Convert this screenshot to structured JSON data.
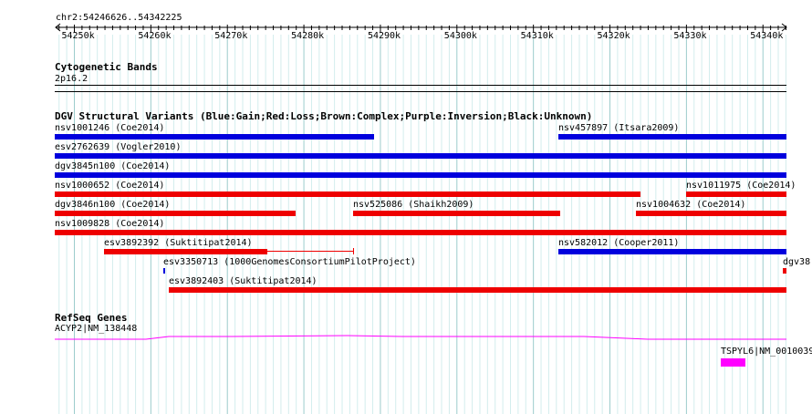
{
  "ruler": {
    "range": "chr2:54246626..54342225",
    "ticks": [
      "54250k",
      "54260k",
      "54270k",
      "54280k",
      "54290k",
      "54300k",
      "54310k",
      "54320k",
      "54330k",
      "54340k"
    ]
  },
  "tracks": {
    "cytoband": {
      "title": "Cytogenetic Bands",
      "band": "2p16.2"
    },
    "dgv": {
      "title": "DGV Structural Variants (Blue:Gain;Red:Loss;Brown:Complex;Purple:Inversion;Black:Unknown)",
      "colors": {
        "gain": "#0000dd",
        "loss": "#ee0000"
      },
      "features": [
        {
          "label": "nsv1001246 (Coe2014)",
          "type": "gain"
        },
        {
          "label": "nsv457897 (Itsara2009)",
          "type": "gain"
        },
        {
          "label": "esv2762639 (Vogler2010)",
          "type": "gain"
        },
        {
          "label": "dgv3845n100 (Coe2014)",
          "type": "gain"
        },
        {
          "label": "nsv1000652 (Coe2014)",
          "type": "loss"
        },
        {
          "label": "nsv1011975 (Coe2014)",
          "type": "loss"
        },
        {
          "label": "dgv3846n100 (Coe2014)",
          "type": "loss"
        },
        {
          "label": "nsv525086 (Shaikh2009)",
          "type": "loss"
        },
        {
          "label": "nsv1004632 (Coe2014)",
          "type": "loss"
        },
        {
          "label": "nsv1009828 (Coe2014)",
          "type": "loss"
        },
        {
          "label": "esv3892392 (Suktitipat2014)",
          "type": "loss"
        },
        {
          "label": "nsv582012 (Cooper2011)",
          "type": "gain"
        },
        {
          "label": "esv3350713 (1000GenomesConsortiumPilotProject)",
          "type": "gain"
        },
        {
          "label": "dgv38",
          "type": "loss"
        },
        {
          "label": "esv3892403 (Suktitipat2014)",
          "type": "loss"
        }
      ]
    },
    "refseq": {
      "title": "RefSeq Genes",
      "color": "#ff00ff",
      "genes": [
        {
          "label": "ACYP2|NM_138448"
        },
        {
          "label": "TSPYL6|NM_0010039"
        }
      ]
    }
  }
}
